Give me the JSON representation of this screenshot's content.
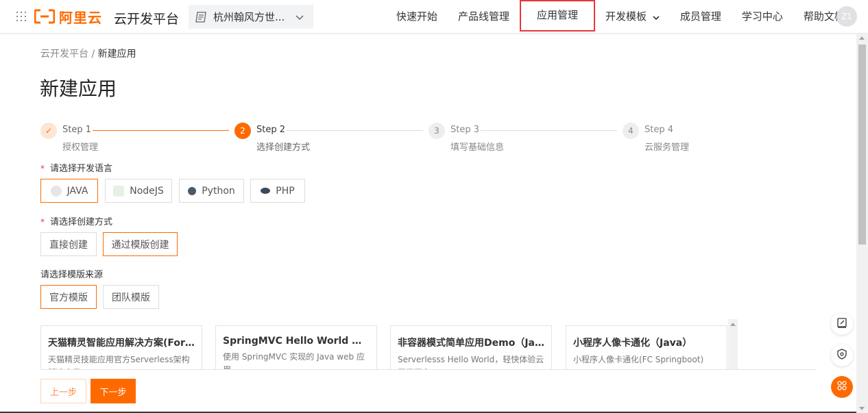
{
  "header": {
    "logo_text": "阿里云",
    "platform_name": "云开发平台",
    "workspace_name": "杭州翰风方世...",
    "nav": [
      "快速开始",
      "产品线管理",
      "应用管理",
      "开发模板",
      "成员管理",
      "学习中心",
      "帮助文档"
    ],
    "avatar_initials": "Z1"
  },
  "breadcrumb": {
    "parent": "云开发平台",
    "separator": "/",
    "current": "新建应用"
  },
  "page_title": "新建应用",
  "steps": [
    {
      "num": "✓",
      "title": "Step 1",
      "desc": "授权管理",
      "status": "done"
    },
    {
      "num": "2",
      "title": "Step 2",
      "desc": "选择创建方式",
      "status": "active"
    },
    {
      "num": "3",
      "title": "Step 3",
      "desc": "填写基础信息",
      "status": "todo"
    },
    {
      "num": "4",
      "title": "Step 4",
      "desc": "云服务管理",
      "status": "todo"
    }
  ],
  "form": {
    "language_label": "请选择开发语言",
    "languages": [
      "JAVA",
      "NodeJS",
      "Python",
      "PHP"
    ],
    "selected_language": "JAVA",
    "method_label": "请选择创建方式",
    "methods": [
      "直接创建",
      "通过模版创建"
    ],
    "selected_method": "通过模版创建",
    "source_label": "请选择模版来源",
    "sources": [
      "官方模版",
      "团队模版"
    ],
    "selected_source": "官方模版"
  },
  "templates": [
    {
      "title": "天猫精灵智能应用解决方案(For ...",
      "desc": "天猫精灵技能应用官方Serverless架构解决方案"
    },
    {
      "title": "SpringMVC Hello World WEB...",
      "desc": "使用 SpringMVC 实现的 Java web 应用"
    },
    {
      "title": "非容器模式简单应用Demo（Ja...",
      "desc": "Serverlesss Hello World，轻快体验云开发平台"
    },
    {
      "title": "小程序人像卡通化（Java）",
      "desc": "小程序人像卡通化(FC Springboot)"
    }
  ],
  "footer": {
    "prev_label": "上一步",
    "next_label": "下一步"
  },
  "colors": {
    "accent": "#ff6a00",
    "highlight": "#e8363a"
  }
}
